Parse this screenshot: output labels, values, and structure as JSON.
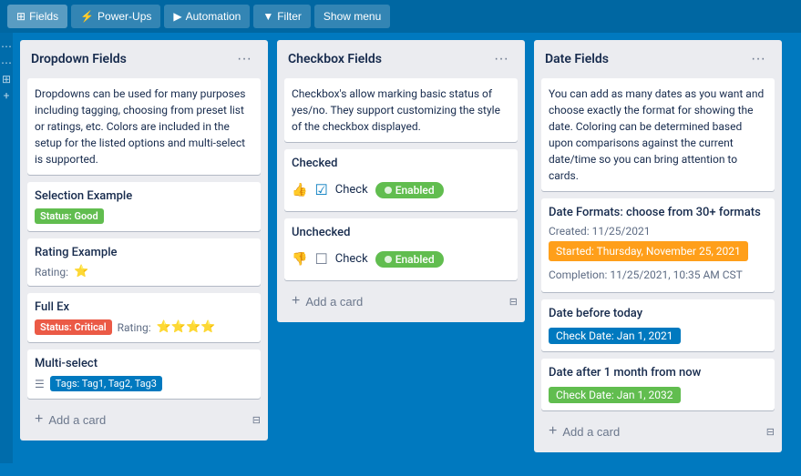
{
  "toolbar": {
    "buttons": [
      {
        "id": "fields",
        "label": "Fields",
        "active": true,
        "icon": "⊞"
      },
      {
        "id": "power-ups",
        "label": "Power-Ups",
        "active": false,
        "icon": "⚡"
      },
      {
        "id": "automation",
        "label": "Automation",
        "active": false,
        "icon": "▶"
      },
      {
        "id": "filter",
        "label": "Filter",
        "active": false,
        "icon": "▼"
      },
      {
        "id": "show-menu",
        "label": "Show menu",
        "active": false,
        "icon": ""
      }
    ]
  },
  "columns": [
    {
      "id": "dropdown-fields",
      "title": "Dropdown Fields",
      "description": "Dropdowns can be used for many purposes including tagging, choosing from preset list or ratings, etc. Colors are included in the setup for the listed options and multi-select is supported.",
      "cards": [
        {
          "id": "selection-example",
          "title": "Selection Example",
          "badge_label": "Status: Good",
          "badge_type": "green"
        },
        {
          "id": "rating-example",
          "title": "Rating Example",
          "rating_label": "Rating:",
          "stars": 1
        },
        {
          "id": "full-ex",
          "title": "Full Ex",
          "status_label": "Status: Critical",
          "status_type": "red",
          "rating_label": "Rating:",
          "stars": 4
        },
        {
          "id": "multi-select",
          "title": "Multi-select",
          "tags_label": "Tags: Tag1, Tag2, Tag3"
        }
      ],
      "add_card_label": "Add a card"
    },
    {
      "id": "checkbox-fields",
      "title": "Checkbox Fields",
      "description": "Checkbox's allow marking basic status of yes/no. They support customizing the style of the checkbox displayed.",
      "cards": [
        {
          "id": "checked",
          "section_label": "Checked",
          "thumb": "👍",
          "check_state": "checked",
          "check_label": "Check",
          "enabled_label": "Enabled"
        },
        {
          "id": "unchecked",
          "section_label": "Unchecked",
          "thumb": "👎",
          "check_state": "unchecked",
          "check_label": "Check",
          "enabled_label": "Enabled"
        }
      ],
      "add_card_label": "Add a card"
    },
    {
      "id": "date-fields",
      "title": "Date Fields",
      "description": "You can add as many dates as you want and choose exactly the format for showing the date. Coloring can be determined based upon comparisons against the current date/time so you can bring attention to cards.",
      "cards": [
        {
          "id": "date-formats",
          "title": "Date Formats: choose from 30+ formats",
          "created_label": "Created: 11/25/2021",
          "started_label": "Started: Thursday, November 25, 2021",
          "started_type": "orange",
          "completion_label": "Completion: 11/25/2021, 10:35 AM CST"
        },
        {
          "id": "date-before-today",
          "title": "Date before today",
          "badge_label": "Check Date: Jan 1, 2021",
          "badge_type": "blue"
        },
        {
          "id": "date-after-month",
          "title": "Date after 1 month from now",
          "badge_label": "Check Date: Jan 1, 2032",
          "badge_type": "green"
        }
      ],
      "add_card_label": "Add a card"
    }
  ]
}
